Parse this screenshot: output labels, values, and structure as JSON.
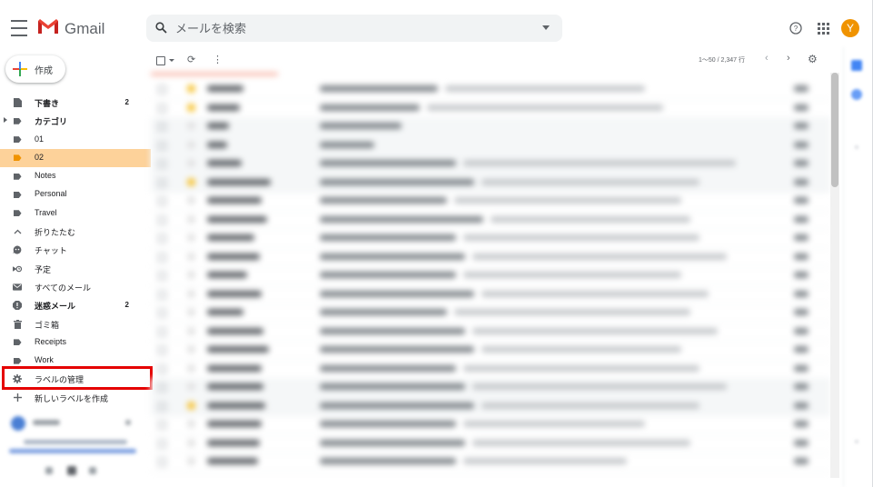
{
  "header": {
    "app_name": "Gmail",
    "search_placeholder": "メールを検索",
    "avatar_letter": "Y",
    "avatar_color": "#f09300"
  },
  "sidebar": {
    "compose_label": "作成",
    "items": [
      {
        "label": "下書き",
        "count": "2",
        "icon": "draft-icon",
        "bold": true
      },
      {
        "label": "カテゴリ",
        "count": "",
        "icon": "label-icon",
        "bold": true,
        "expandable": true
      },
      {
        "label": "01",
        "count": "",
        "icon": "label-icon"
      },
      {
        "label": "02",
        "count": "",
        "icon": "label-icon",
        "active": true
      },
      {
        "label": "Notes",
        "count": "",
        "icon": "label-icon"
      },
      {
        "label": "Personal",
        "count": "",
        "icon": "label-icon"
      },
      {
        "label": "Travel",
        "count": "",
        "icon": "label-icon"
      },
      {
        "label": "折りたたむ",
        "count": "",
        "icon": "chevron-up-icon"
      },
      {
        "label": "チャット",
        "count": "",
        "icon": "chat-icon"
      },
      {
        "label": "予定",
        "count": "",
        "icon": "scheduled-icon"
      },
      {
        "label": "すべてのメール",
        "count": "",
        "icon": "mail-icon"
      },
      {
        "label": "迷惑メール",
        "count": "2",
        "icon": "spam-icon",
        "bold": true
      },
      {
        "label": "ゴミ箱",
        "count": "",
        "icon": "trash-icon"
      },
      {
        "label": "Receipts",
        "count": "",
        "icon": "label-icon"
      },
      {
        "label": "Work",
        "count": "",
        "icon": "label-icon"
      },
      {
        "label": "ラベルの管理",
        "count": "",
        "icon": "gear-icon"
      },
      {
        "label": "新しいラベルを作成",
        "count": "",
        "icon": "plus-icon"
      }
    ]
  },
  "toolbar": {
    "pager": "1～50 / 2,347 行"
  },
  "colors": {
    "active_label_bg": "#fdd29a",
    "highlight_border": "#e50000"
  }
}
